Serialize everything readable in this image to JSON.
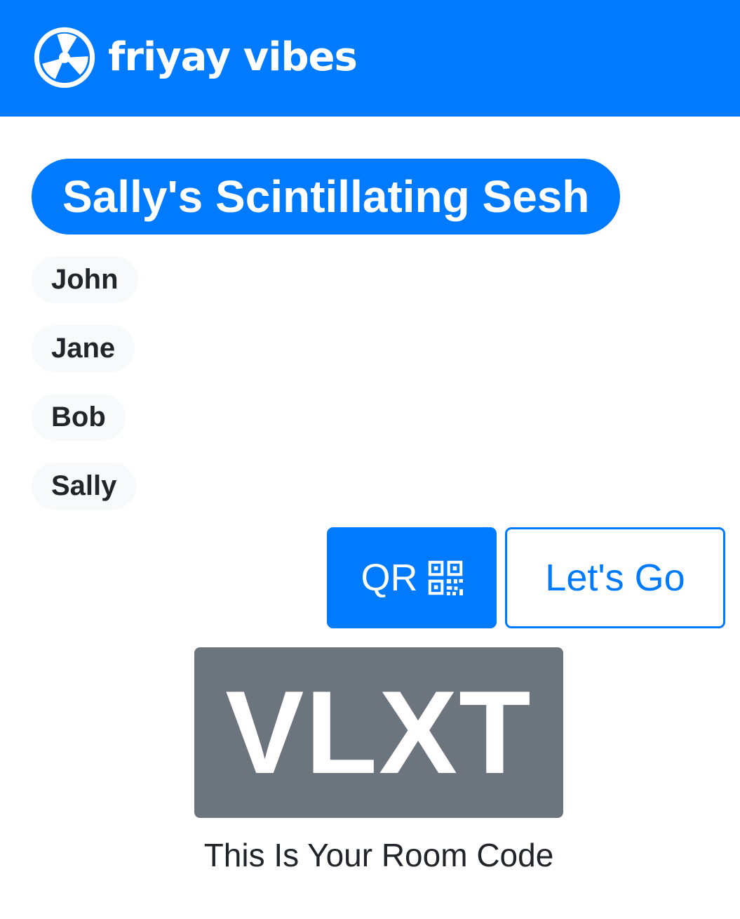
{
  "app": {
    "name": "friyay vibes",
    "logo_icon": "fan-icon",
    "accent_color": "#007bff"
  },
  "session": {
    "title": "Sally's Scintillating Sesh"
  },
  "players": [
    {
      "name": "John"
    },
    {
      "name": "Jane"
    },
    {
      "name": "Bob"
    },
    {
      "name": "Sally"
    }
  ],
  "actions": {
    "qr_label": "QR",
    "qr_icon": "qr-code-icon",
    "go_label": "Let's Go"
  },
  "room": {
    "code": "VLXT",
    "caption": "This Is Your Room Code",
    "badge_color": "#6c757d"
  }
}
